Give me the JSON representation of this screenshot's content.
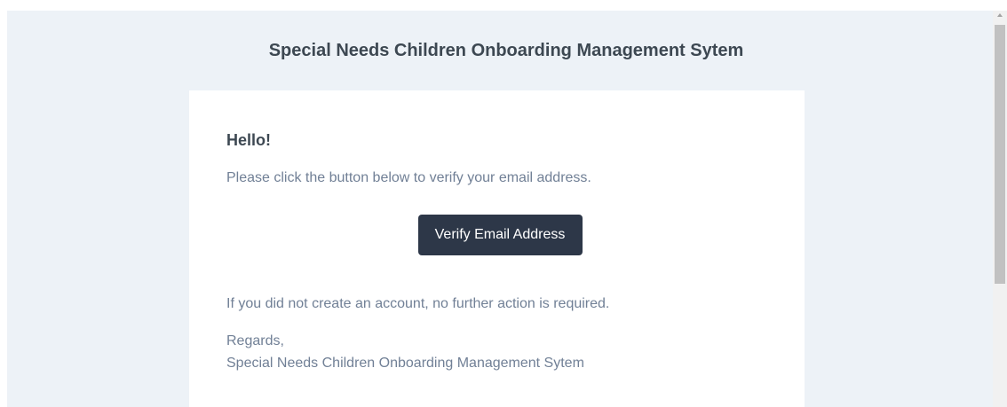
{
  "header": {
    "title": "Special Needs Children Onboarding Management Sytem"
  },
  "email": {
    "greeting": "Hello!",
    "intro": "Please click the button below to verify your email address.",
    "button_label": "Verify Email Address",
    "outro": "If you did not create an account, no further action is required.",
    "salutation": "Regards,",
    "signature": "Special Needs Children Onboarding Management Sytem"
  },
  "colors": {
    "page_background": "#edf2f7",
    "card_background": "#ffffff",
    "button_background": "#2d3748",
    "heading_text": "#3d4852",
    "body_text": "#718096"
  },
  "scrollbar": {
    "up_icon": "scroll-up-arrow-icon"
  }
}
